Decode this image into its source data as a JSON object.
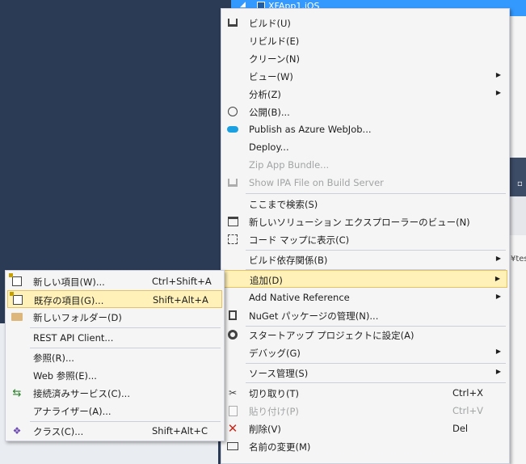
{
  "solution_explorer": {
    "project_label": "XFApp1.iOS"
  },
  "background": {
    "path_fragment": "¥tes"
  },
  "context_menu": {
    "items": [
      {
        "label": "ビルド(U)",
        "icon": "build-icon"
      },
      {
        "label": "リビルド(E)"
      },
      {
        "label": "クリーン(N)"
      },
      {
        "label": "ビュー(W)",
        "submenu": true
      },
      {
        "label": "分析(Z)",
        "submenu": true
      },
      {
        "label": "公開(B)...",
        "icon": "globe-icon"
      },
      {
        "label": "Publish as Azure WebJob...",
        "icon": "cloud-icon"
      },
      {
        "label": "Deploy..."
      },
      {
        "label": "Zip App Bundle...",
        "disabled": true
      },
      {
        "label": "Show IPA File on Build Server",
        "disabled": true,
        "icon": "build-server-icon"
      },
      {
        "label": "ここまで検索(S)"
      },
      {
        "label": "新しいソリューション エクスプローラーのビュー(N)",
        "icon": "new-view-icon"
      },
      {
        "label": "コード マップに表示(C)",
        "icon": "code-map-icon"
      },
      {
        "label": "ビルド依存関係(B)",
        "submenu": true
      },
      {
        "label": "追加(D)",
        "submenu": true,
        "highlight": true
      },
      {
        "label": "Add Native Reference",
        "submenu": true
      },
      {
        "label": "NuGet パッケージの管理(N)...",
        "icon": "nuget-icon"
      },
      {
        "label": "スタートアップ プロジェクトに設定(A)",
        "icon": "gear-icon"
      },
      {
        "label": "デバッグ(G)",
        "submenu": true
      },
      {
        "label": "ソース管理(S)",
        "submenu": true
      },
      {
        "label": "切り取り(T)",
        "shortcut": "Ctrl+X",
        "icon": "scissors-icon"
      },
      {
        "label": "貼り付け(P)",
        "shortcut": "Ctrl+V",
        "disabled": true,
        "icon": "paste-icon"
      },
      {
        "label": "削除(V)",
        "shortcut": "Del",
        "icon": "delete-icon"
      },
      {
        "label": "名前の変更(M)",
        "icon": "rename-icon"
      }
    ]
  },
  "add_submenu": {
    "items": [
      {
        "label": "新しい項目(W)...",
        "shortcut": "Ctrl+Shift+A",
        "icon": "new-item-icon"
      },
      {
        "label": "既存の項目(G)...",
        "shortcut": "Shift+Alt+A",
        "icon": "existing-item-icon",
        "highlight": true
      },
      {
        "label": "新しいフォルダー(D)",
        "icon": "new-folder-icon"
      },
      {
        "label": "REST API Client..."
      },
      {
        "label": "参照(R)..."
      },
      {
        "label": "Web 参照(E)..."
      },
      {
        "label": "接続済みサービス(C)...",
        "icon": "connected-service-icon"
      },
      {
        "label": "アナライザー(A)..."
      },
      {
        "label": "クラス(C)...",
        "shortcut": "Shift+Alt+C",
        "icon": "class-icon"
      }
    ]
  },
  "colors": {
    "highlight_bg": "#fff1b8",
    "menu_bg": "#f5f5f5",
    "ide_bg": "#2c3b55",
    "selection_blue": "#3399ff"
  }
}
